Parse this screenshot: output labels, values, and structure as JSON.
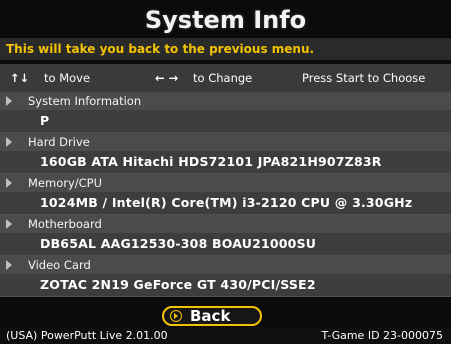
{
  "screen": {
    "title": "System Info",
    "subtitle": "This will take you back to the previous menu.",
    "controls": {
      "move_icon": "↑↓",
      "move_label": "to Move",
      "change_icon": "← →",
      "change_label": "to Change",
      "start_label": "Press Start to Choose"
    },
    "rows": [
      {
        "label": "System Information",
        "value": "P"
      },
      {
        "label": "Hard Drive",
        "value": "160GB ATA Hitachi HDS72101 JPA821H907Z83R"
      },
      {
        "label": "Memory/CPU",
        "value": "1024MB / Intel(R) Core(TM) i3-2120 CPU @ 3.30GHz"
      },
      {
        "label": "Motherboard",
        "value": "DB65AL AAG12530-308 BOAU21000SU"
      },
      {
        "label": "Video Card",
        "value": "ZOTAC 2N19 GeForce GT 430/PCI/SSE2"
      }
    ],
    "back_label": "Back",
    "footer": {
      "left": "(USA) PowerPutt Live 2.01.00",
      "right": "T-Game ID 23-000075"
    }
  },
  "colors": {
    "accent": "#f3c200",
    "background": "#0b0b0b"
  }
}
